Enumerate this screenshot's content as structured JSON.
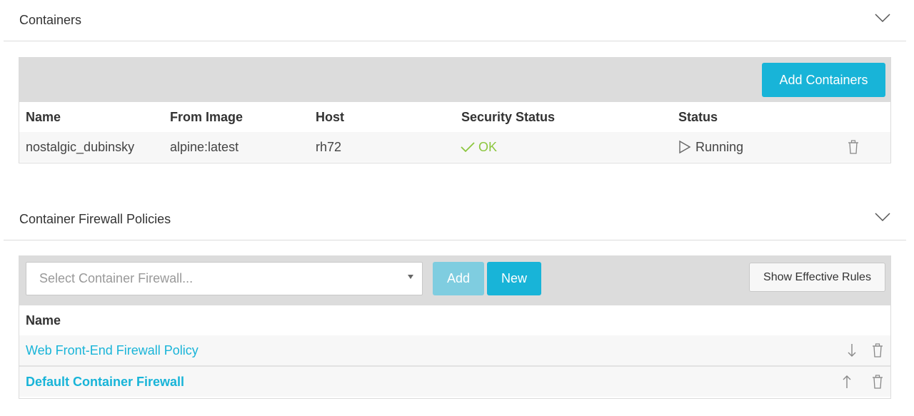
{
  "containers_section": {
    "title": "Containers",
    "add_button": "Add Containers",
    "columns": [
      "Name",
      "From Image",
      "Host",
      "Security Status",
      "Status"
    ],
    "rows": [
      {
        "name": "nostalgic_dubinsky",
        "image": "alpine:latest",
        "host": "rh72",
        "security_status": "OK",
        "status": "Running"
      }
    ]
  },
  "firewall_section": {
    "title": "Container Firewall Policies",
    "select_placeholder": "Select Container Firewall...",
    "add_button": "Add",
    "new_button": "New",
    "show_rules_button": "Show Effective Rules",
    "columns": [
      "Name"
    ],
    "rows": [
      {
        "name": "Web Front-End Firewall Policy",
        "move_icon": "arrow-down-icon"
      },
      {
        "name": "Default Container Firewall",
        "move_icon": "arrow-up-icon"
      }
    ]
  },
  "colors": {
    "accent": "#18b4d8",
    "ok": "#8cc63f",
    "toolbar": "#dcdcdc"
  }
}
